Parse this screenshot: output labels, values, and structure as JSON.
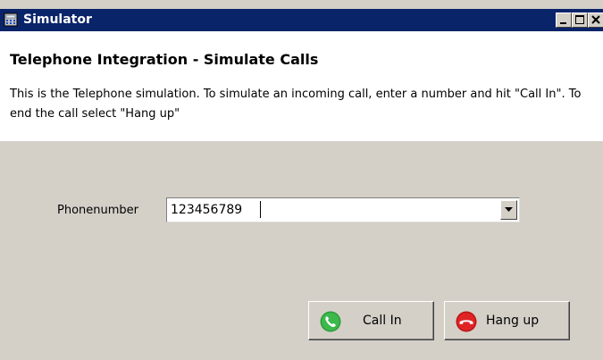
{
  "window": {
    "title": "Simulator",
    "controls": {
      "minimize": "_",
      "maximize": "□",
      "close": "×"
    }
  },
  "header": {
    "title": "Telephone Integration - Simulate Calls",
    "description": "This is the Telephone simulation. To simulate an incoming call, enter a number and hit \"Call In\". To end the call select \"Hang up\""
  },
  "form": {
    "phone_label": "Phonenumber",
    "phone_value": "123456789"
  },
  "buttons": {
    "call_in": "Call In",
    "hang_up": "Hang up"
  },
  "colors": {
    "titlebar": "#0a246a",
    "call_in_icon": "#2e9b3a",
    "hang_up_icon": "#d81e1e"
  },
  "icons": {
    "app": "calculator-icon",
    "call_in": "phone-green-icon",
    "hang_up": "phone-red-icon"
  }
}
